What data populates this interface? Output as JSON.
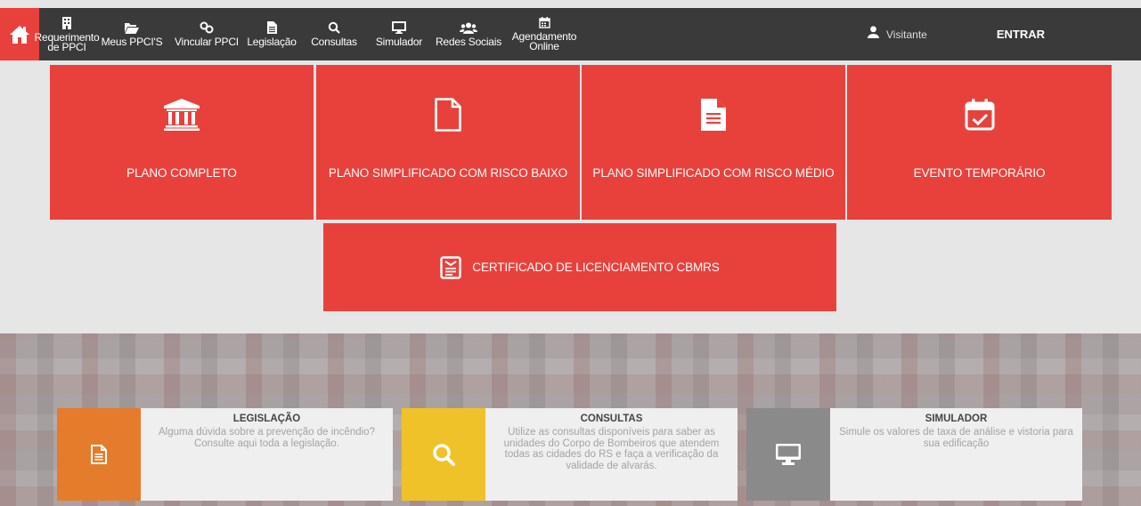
{
  "nav": {
    "items": [
      {
        "label": "Requerimento\nde PPCI",
        "icon": "building-icon"
      },
      {
        "label": "Meus PPCI'S",
        "icon": "folder-open-icon"
      },
      {
        "label": "Vincular PPCI",
        "icon": "link-icon"
      },
      {
        "label": "Legislação",
        "icon": "document-icon"
      },
      {
        "label": "Consultas",
        "icon": "search-icon"
      },
      {
        "label": "Simulador",
        "icon": "monitor-icon"
      },
      {
        "label": "Redes Sociais",
        "icon": "users-icon"
      },
      {
        "label": "Agendamento\nOnline",
        "icon": "calendar-icon"
      }
    ],
    "user": "Visitante",
    "login": "ENTRAR"
  },
  "tiles": [
    {
      "label": "PLANO COMPLETO",
      "icon": "bank-icon"
    },
    {
      "label": "PLANO SIMPLIFICADO COM RISCO BAIXO",
      "icon": "blank-file-icon"
    },
    {
      "label": "PLANO SIMPLIFICADO COM RISCO MÉDIO",
      "icon": "text-file-icon"
    },
    {
      "label": "EVENTO TEMPORÁRIO",
      "icon": "calendar-check-icon"
    },
    {
      "label": "CERTIFICADO DE LICENCIAMENTO CBMRS",
      "icon": "certificate-icon"
    }
  ],
  "cards": [
    {
      "title": "LEGISLAÇÃO",
      "text": "Alguma dúvida sobre a prevenção de incêndio? Consulte aqui toda a legislação.",
      "color": "#e57c2c",
      "icon": "document-icon"
    },
    {
      "title": "CONSULTAS",
      "text": "Utilize as consultas disponíveis para saber as unidades do Corpo de Bombeiros que atendem todas as cidades do RS e faça a verificação da validade de alvarás.",
      "color": "#f0c22a",
      "icon": "search-icon"
    },
    {
      "title": "SIMULADOR",
      "text": "Simule os valores de taxa de análise e vistoria para sua edificação",
      "color": "#8a8a8a",
      "icon": "monitor-icon"
    }
  ],
  "colors": {
    "accent": "#e8413c",
    "navbar": "#3a3a3a"
  }
}
